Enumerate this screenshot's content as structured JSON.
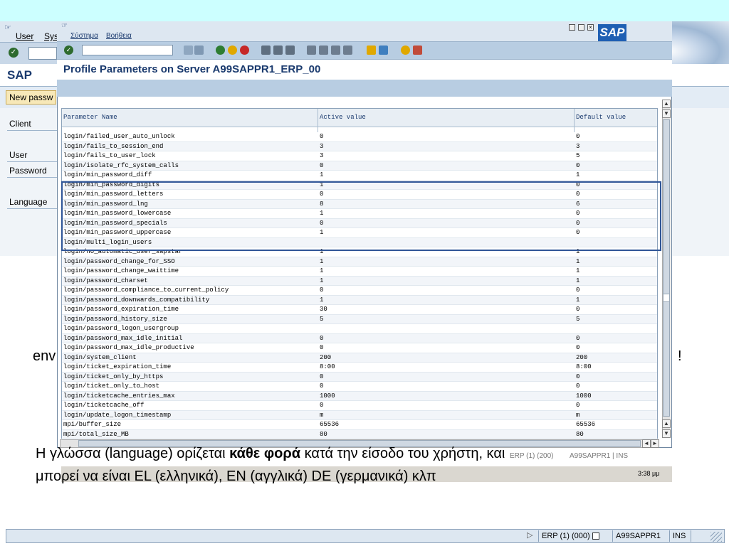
{
  "background_window": {
    "menu": [
      "User",
      "Sys"
    ],
    "title": "SAP",
    "new_password_button": "New passw",
    "labels": {
      "client": "Client",
      "user": "User",
      "password": "Password",
      "language": "Language"
    },
    "behind_text_left": "env",
    "behind_text_right": "!"
  },
  "dialog": {
    "menu": [
      "Σύστημα",
      "Βοήθεια"
    ],
    "title": "Profile Parameters on Server A99SAPPR1_ERP_00",
    "logo": "SAP",
    "columns": [
      "Parameter Name",
      "Active value",
      "Default value"
    ],
    "rows": [
      [
        "login/failed_user_auto_unlock",
        "0",
        "0"
      ],
      [
        "login/fails_to_session_end",
        "3",
        "3"
      ],
      [
        "login/fails_to_user_lock",
        "3",
        "5"
      ],
      [
        "login/isolate_rfc_system_calls",
        "0",
        "0"
      ],
      [
        "login/min_password_diff",
        "1",
        "1"
      ],
      [
        "login/min_password_digits",
        "1",
        "0"
      ],
      [
        "login/min_password_letters",
        "0",
        "0"
      ],
      [
        "login/min_password_lng",
        "8",
        "6"
      ],
      [
        "login/min_password_lowercase",
        "1",
        "0"
      ],
      [
        "login/min_password_specials",
        "0",
        "0"
      ],
      [
        "login/min_password_uppercase",
        "1",
        "0"
      ],
      [
        "login/multi_login_users",
        "",
        ""
      ],
      [
        "login/no_automatic_user_sapstar",
        "1",
        "1"
      ],
      [
        "login/password_change_for_SSO",
        "1",
        "1"
      ],
      [
        "login/password_change_waittime",
        "1",
        "1"
      ],
      [
        "login/password_charset",
        "1",
        "1"
      ],
      [
        "login/password_compliance_to_current_policy",
        "0",
        "0"
      ],
      [
        "login/password_downwards_compatibility",
        "1",
        "1"
      ],
      [
        "login/password_expiration_time",
        "30",
        "0"
      ],
      [
        "login/password_history_size",
        "5",
        "5"
      ],
      [
        "login/password_logon_usergroup",
        "",
        ""
      ],
      [
        "login/password_max_idle_initial",
        "0",
        "0"
      ],
      [
        "login/password_max_idle_productive",
        "0",
        "0"
      ],
      [
        "login/system_client",
        "200",
        "200"
      ],
      [
        "login/ticket_expiration_time",
        "8:00",
        "8:00"
      ],
      [
        "login/ticket_only_by_https",
        "0",
        "0"
      ],
      [
        "login/ticket_only_to_host",
        "0",
        "0"
      ],
      [
        "login/ticketcache_entries_max",
        "1000",
        "1000"
      ],
      [
        "login/ticketcache_off",
        "0",
        "0"
      ],
      [
        "login/update_logon_timestamp",
        "m",
        "m"
      ],
      [
        "mpi/buffer_size",
        "65536",
        "65536"
      ],
      [
        "mpi/total_size_MB",
        "80",
        "80"
      ]
    ]
  },
  "caption": {
    "line1_prefix": "Η γλώσσα (language) ορίζεται ",
    "line1_bold": "κάθε φορά",
    "line1_suffix": " κατά την είσοδο του χρήστη, και",
    "line2": "μπορεί να είναι EL (ελληνικά), EN (αγγλικά) DE (γερμανικά) κλπ"
  },
  "taskbar": {
    "time": "3:38 μμ",
    "status_echo": "ERP (1) (200)",
    "server_echo": "A99SAPPR1 | INS"
  },
  "status_bar": {
    "system": "ERP (1) (000)",
    "server": "A99SAPPR1",
    "mode": "INS"
  }
}
